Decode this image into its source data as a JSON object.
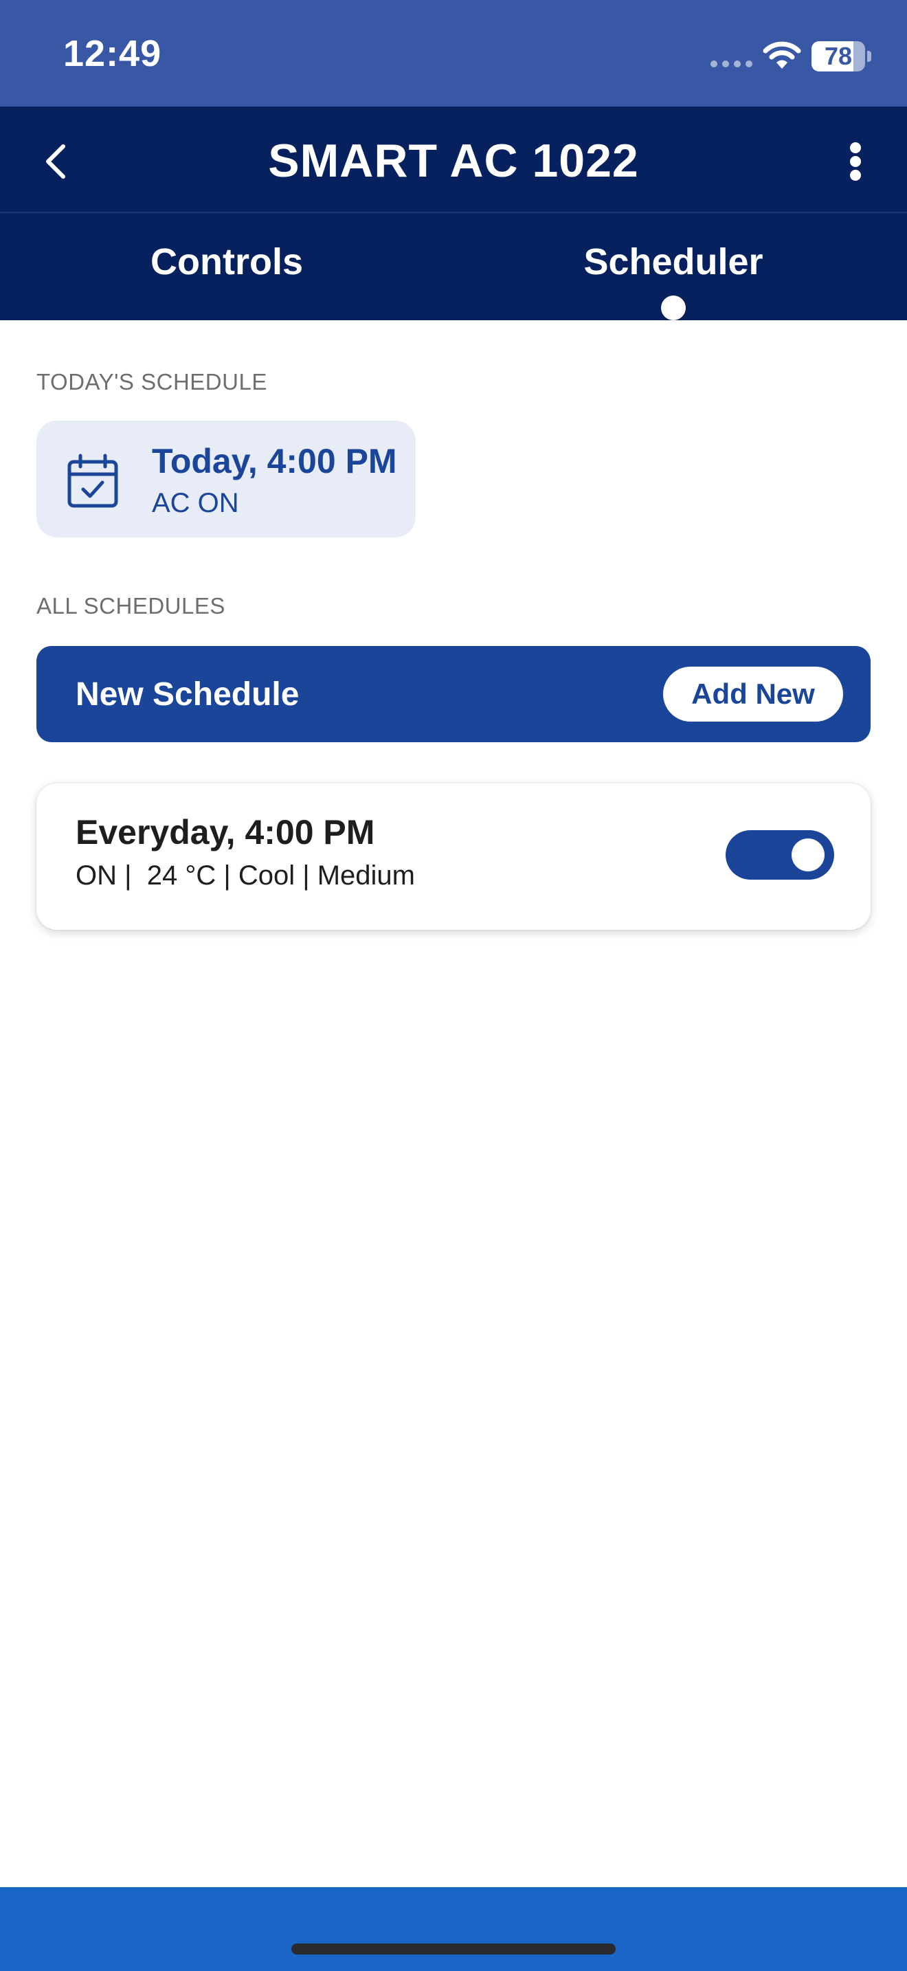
{
  "status_bar": {
    "time": "12:49",
    "battery_level": "78",
    "icons": [
      "signal-icon",
      "wifi-icon",
      "battery-icon"
    ]
  },
  "header": {
    "title": "SMART AC 1022",
    "back_icon": "chevron-left-icon",
    "menu_icon": "more-vertical-icon"
  },
  "tabs": [
    {
      "label": "Controls",
      "selected": false
    },
    {
      "label": "Scheduler",
      "selected": true
    }
  ],
  "today": {
    "section_label": "TODAY'S SCHEDULE",
    "icon": "calendar-check-icon",
    "title": "Today, 4:00 PM",
    "subtitle": "AC ON"
  },
  "all_schedules": {
    "section_label": "ALL SCHEDULES",
    "new_schedule_label": "New Schedule",
    "add_new_label": "Add New",
    "items": [
      {
        "title": "Everyday, 4:00 PM",
        "details": "ON |  24 °C | Cool | Medium",
        "enabled": true
      }
    ]
  },
  "colors": {
    "status_bar": "#3857a4",
    "app_bar": "#06215d",
    "accent": "#1a4598",
    "card_tint": "#e7ecf6",
    "bottom_bar": "#1966c6"
  }
}
